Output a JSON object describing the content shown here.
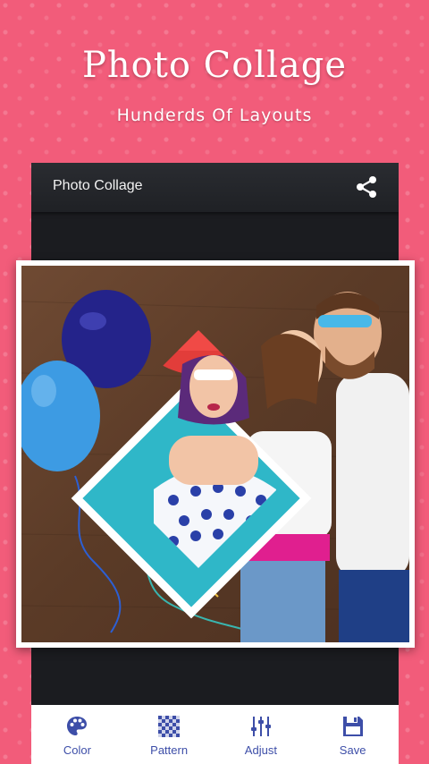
{
  "promo": {
    "title": "Photo Collage",
    "subtitle": "Hunderds Of Layouts"
  },
  "app_bar": {
    "title": "Photo Collage",
    "share_icon": "share-icon"
  },
  "bottom_nav": [
    {
      "label": "Color",
      "icon": "palette-icon"
    },
    {
      "label": "Pattern",
      "icon": "checkerboard-icon"
    },
    {
      "label": "Adjust",
      "icon": "sliders-icon"
    },
    {
      "label": "Save",
      "icon": "floppy-disk-icon"
    }
  ],
  "colors": {
    "background": "#f25c7a",
    "toolbar": "#25272b",
    "nav_accent": "#3d4ea8"
  }
}
